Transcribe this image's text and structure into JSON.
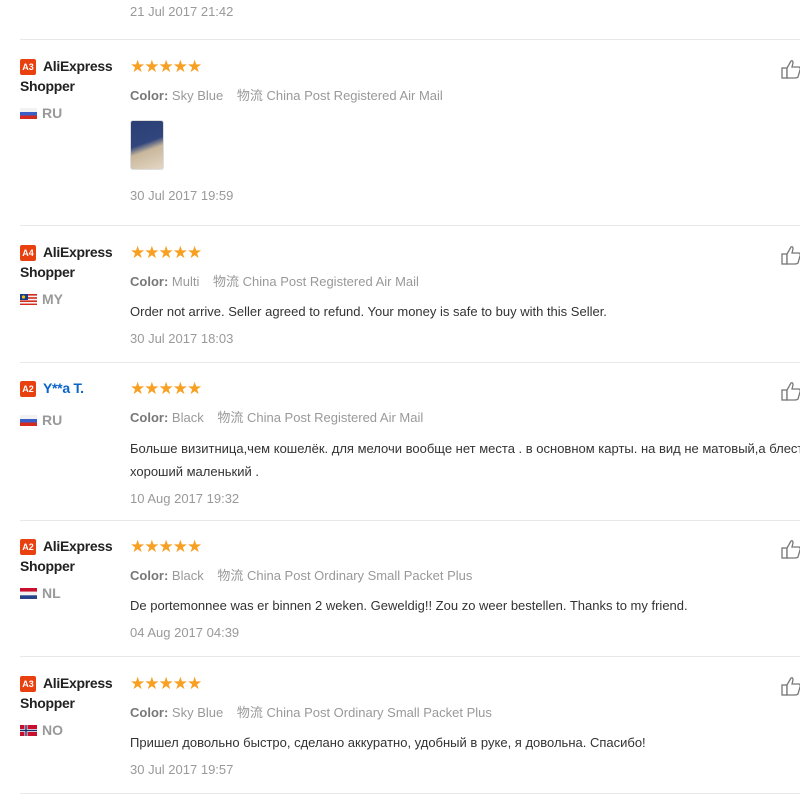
{
  "top_date": "21 Jul 2017 21:42",
  "reviews": [
    {
      "badge": "A3",
      "name_line1": "AliExpress",
      "name_line2": "Shopper",
      "country": "RU",
      "stars": "★★★★★",
      "color_label": "Color:",
      "color_value": "Sky Blue",
      "logistics_label": "物流",
      "logistics_value": "China Post Registered Air Mail",
      "text": "",
      "date": "30 Jul 2017 19:59"
    },
    {
      "badge": "A4",
      "name_line1": "AliExpress",
      "name_line2": "Shopper",
      "country": "MY",
      "stars": "★★★★★",
      "color_label": "Color:",
      "color_value": "Multi",
      "logistics_label": "物流",
      "logistics_value": "China Post Registered Air Mail",
      "text": "Order not arrive. Seller agreed to refund. Your money is safe to buy with this Seller.",
      "date": "30 Jul 2017 18:03"
    },
    {
      "badge": "A2",
      "name_line1": "Y**a T.",
      "name_line2": "",
      "country": "RU",
      "stars": "★★★★★",
      "color_label": "Color:",
      "color_value": "Black",
      "logistics_label": "物流",
      "logistics_value": "China Post Registered Air Mail",
      "text": "Больше визитница,чем кошелёк. для мелочи вообще нет места . в основном карты. на вид не матовый,а блестит. в целом",
      "text2": "хороший маленький .",
      "date": "10 Aug 2017 19:32"
    },
    {
      "badge": "A2",
      "name_line1": "AliExpress",
      "name_line2": "Shopper",
      "country": "NL",
      "stars": "★★★★★",
      "color_label": "Color:",
      "color_value": "Black",
      "logistics_label": "物流",
      "logistics_value": "China Post Ordinary Small Packet Plus",
      "text": "De portemonnee was er binnen 2 weken. Geweldig!! Zou zo weer bestellen. Thanks to my friend.",
      "date": "04 Aug 2017 04:39"
    },
    {
      "badge": "A3",
      "name_line1": "AliExpress",
      "name_line2": "Shopper",
      "country": "NO",
      "stars": "★★★★★",
      "color_label": "Color:",
      "color_value": "Sky Blue",
      "logistics_label": "物流",
      "logistics_value": "China Post Ordinary Small Packet Plus",
      "text": "Пришел довольно быстро, сделано аккуратно, удобный в руке, я довольна. Спасибо!",
      "date": "30 Jul 2017 19:57"
    }
  ]
}
